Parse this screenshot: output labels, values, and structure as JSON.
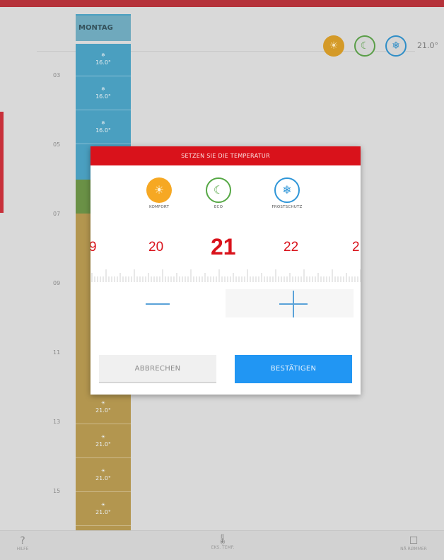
{
  "schedule": {
    "day": "MONTAG",
    "current_temp": "21.0°",
    "hours": [
      "03",
      "05",
      "07",
      "09",
      "11",
      "13",
      "15"
    ],
    "slots_top": [
      "16.0°",
      "16.0°",
      "16.0°"
    ],
    "slots_bottom": [
      "21.0°",
      "21.0°",
      "21.0°",
      "21.0°"
    ]
  },
  "modal": {
    "title": "SETZEN SIE DIE TEMPERATUR",
    "modes": [
      {
        "label": "KOMFORT",
        "icon": "sun-icon"
      },
      {
        "label": "ECO",
        "icon": "moon-icon"
      },
      {
        "label": "FROSTSCHUTZ",
        "icon": "snowflake-icon"
      }
    ],
    "picker": {
      "left_partial": "9",
      "prev": "20",
      "selected": "21",
      "next": "22",
      "right_partial": "2"
    },
    "cancel_label": "ABBRECHEN",
    "confirm_label": "BESTÄTIGEN"
  },
  "bottom_bar": {
    "help": "HILFE",
    "temp": "EKS. TEMP.",
    "rooms": "NÅ RØMMER"
  },
  "colors": {
    "accent_red": "#d9121b",
    "confirm_blue": "#2196f3",
    "comfort": "#f6a823",
    "eco": "#56a845",
    "frost": "#2f96d8"
  }
}
